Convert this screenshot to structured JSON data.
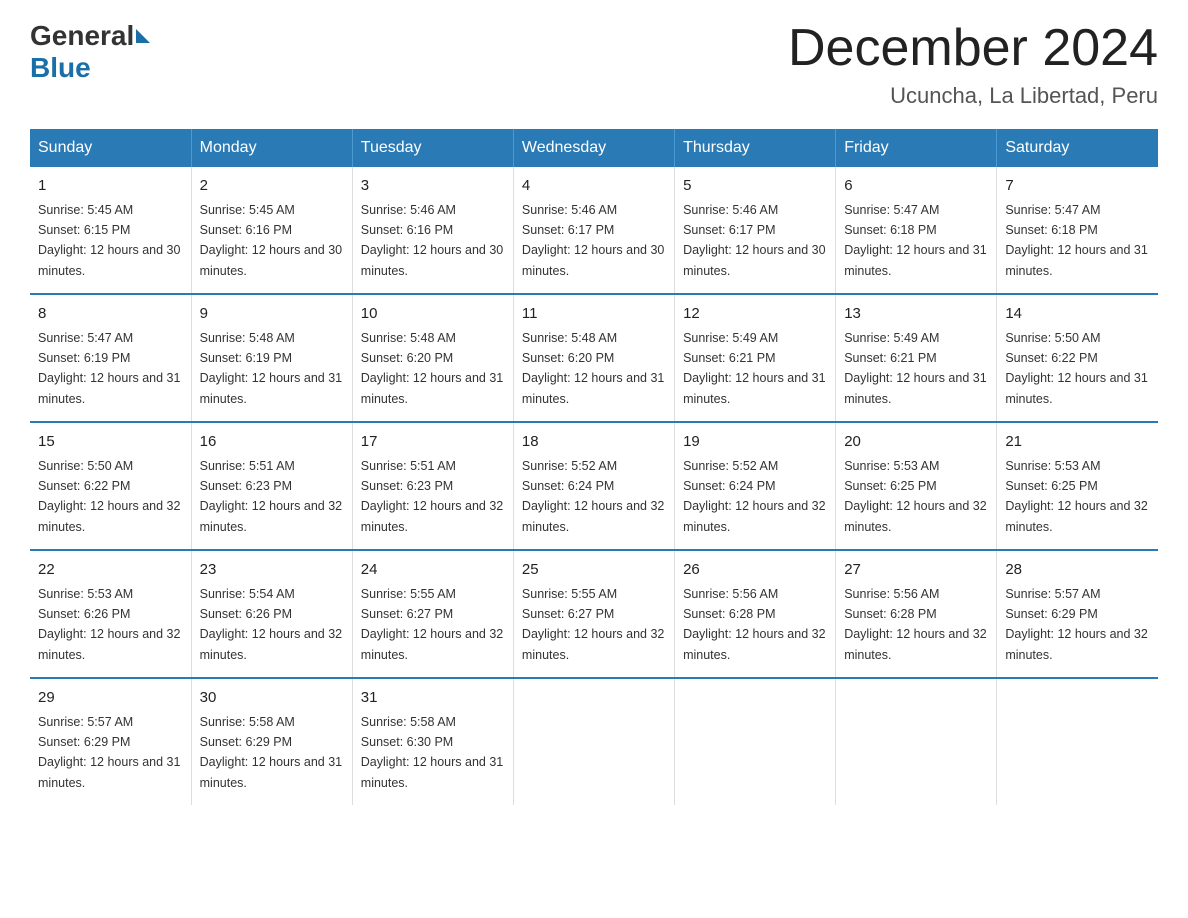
{
  "header": {
    "logo_general": "General",
    "logo_blue": "Blue",
    "month_title": "December 2024",
    "location": "Ucuncha, La Libertad, Peru"
  },
  "days_of_week": [
    "Sunday",
    "Monday",
    "Tuesday",
    "Wednesday",
    "Thursday",
    "Friday",
    "Saturday"
  ],
  "weeks": [
    [
      {
        "day": "1",
        "sunrise": "5:45 AM",
        "sunset": "6:15 PM",
        "daylight": "12 hours and 30 minutes."
      },
      {
        "day": "2",
        "sunrise": "5:45 AM",
        "sunset": "6:16 PM",
        "daylight": "12 hours and 30 minutes."
      },
      {
        "day": "3",
        "sunrise": "5:46 AM",
        "sunset": "6:16 PM",
        "daylight": "12 hours and 30 minutes."
      },
      {
        "day": "4",
        "sunrise": "5:46 AM",
        "sunset": "6:17 PM",
        "daylight": "12 hours and 30 minutes."
      },
      {
        "day": "5",
        "sunrise": "5:46 AM",
        "sunset": "6:17 PM",
        "daylight": "12 hours and 30 minutes."
      },
      {
        "day": "6",
        "sunrise": "5:47 AM",
        "sunset": "6:18 PM",
        "daylight": "12 hours and 31 minutes."
      },
      {
        "day": "7",
        "sunrise": "5:47 AM",
        "sunset": "6:18 PM",
        "daylight": "12 hours and 31 minutes."
      }
    ],
    [
      {
        "day": "8",
        "sunrise": "5:47 AM",
        "sunset": "6:19 PM",
        "daylight": "12 hours and 31 minutes."
      },
      {
        "day": "9",
        "sunrise": "5:48 AM",
        "sunset": "6:19 PM",
        "daylight": "12 hours and 31 minutes."
      },
      {
        "day": "10",
        "sunrise": "5:48 AM",
        "sunset": "6:20 PM",
        "daylight": "12 hours and 31 minutes."
      },
      {
        "day": "11",
        "sunrise": "5:48 AM",
        "sunset": "6:20 PM",
        "daylight": "12 hours and 31 minutes."
      },
      {
        "day": "12",
        "sunrise": "5:49 AM",
        "sunset": "6:21 PM",
        "daylight": "12 hours and 31 minutes."
      },
      {
        "day": "13",
        "sunrise": "5:49 AM",
        "sunset": "6:21 PM",
        "daylight": "12 hours and 31 minutes."
      },
      {
        "day": "14",
        "sunrise": "5:50 AM",
        "sunset": "6:22 PM",
        "daylight": "12 hours and 31 minutes."
      }
    ],
    [
      {
        "day": "15",
        "sunrise": "5:50 AM",
        "sunset": "6:22 PM",
        "daylight": "12 hours and 32 minutes."
      },
      {
        "day": "16",
        "sunrise": "5:51 AM",
        "sunset": "6:23 PM",
        "daylight": "12 hours and 32 minutes."
      },
      {
        "day": "17",
        "sunrise": "5:51 AM",
        "sunset": "6:23 PM",
        "daylight": "12 hours and 32 minutes."
      },
      {
        "day": "18",
        "sunrise": "5:52 AM",
        "sunset": "6:24 PM",
        "daylight": "12 hours and 32 minutes."
      },
      {
        "day": "19",
        "sunrise": "5:52 AM",
        "sunset": "6:24 PM",
        "daylight": "12 hours and 32 minutes."
      },
      {
        "day": "20",
        "sunrise": "5:53 AM",
        "sunset": "6:25 PM",
        "daylight": "12 hours and 32 minutes."
      },
      {
        "day": "21",
        "sunrise": "5:53 AM",
        "sunset": "6:25 PM",
        "daylight": "12 hours and 32 minutes."
      }
    ],
    [
      {
        "day": "22",
        "sunrise": "5:53 AM",
        "sunset": "6:26 PM",
        "daylight": "12 hours and 32 minutes."
      },
      {
        "day": "23",
        "sunrise": "5:54 AM",
        "sunset": "6:26 PM",
        "daylight": "12 hours and 32 minutes."
      },
      {
        "day": "24",
        "sunrise": "5:55 AM",
        "sunset": "6:27 PM",
        "daylight": "12 hours and 32 minutes."
      },
      {
        "day": "25",
        "sunrise": "5:55 AM",
        "sunset": "6:27 PM",
        "daylight": "12 hours and 32 minutes."
      },
      {
        "day": "26",
        "sunrise": "5:56 AM",
        "sunset": "6:28 PM",
        "daylight": "12 hours and 32 minutes."
      },
      {
        "day": "27",
        "sunrise": "5:56 AM",
        "sunset": "6:28 PM",
        "daylight": "12 hours and 32 minutes."
      },
      {
        "day": "28",
        "sunrise": "5:57 AM",
        "sunset": "6:29 PM",
        "daylight": "12 hours and 32 minutes."
      }
    ],
    [
      {
        "day": "29",
        "sunrise": "5:57 AM",
        "sunset": "6:29 PM",
        "daylight": "12 hours and 31 minutes."
      },
      {
        "day": "30",
        "sunrise": "5:58 AM",
        "sunset": "6:29 PM",
        "daylight": "12 hours and 31 minutes."
      },
      {
        "day": "31",
        "sunrise": "5:58 AM",
        "sunset": "6:30 PM",
        "daylight": "12 hours and 31 minutes."
      },
      {
        "day": "",
        "sunrise": "",
        "sunset": "",
        "daylight": ""
      },
      {
        "day": "",
        "sunrise": "",
        "sunset": "",
        "daylight": ""
      },
      {
        "day": "",
        "sunrise": "",
        "sunset": "",
        "daylight": ""
      },
      {
        "day": "",
        "sunrise": "",
        "sunset": "",
        "daylight": ""
      }
    ]
  ]
}
